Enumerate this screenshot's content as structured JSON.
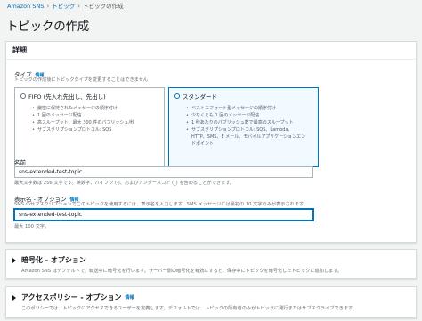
{
  "breadcrumb": {
    "items": [
      "Amazon SNS",
      "トピック",
      "トピックの作成"
    ]
  },
  "page": {
    "title": "トピックの作成"
  },
  "details": {
    "heading": "詳細",
    "type": {
      "label": "タイプ",
      "info": "情報",
      "description": "トピックの作成後にトピックタイプを変更することはできません",
      "options": [
        {
          "label": "FIFO (先入れ先出し、先出し)",
          "selected": false,
          "bullets": [
            "厳密に保持されたメッセージの順序付け",
            "1 回のメッセージ配信",
            "高スループット、最大 300 件のパブリッシュ/秒",
            "サブスクリプションプロトコル: SQS"
          ]
        },
        {
          "label": "スタンダード",
          "selected": true,
          "bullets": [
            "ベストエフォート型メッセージの順序付け",
            "少なくとも 1 回のメッセージ配信",
            "1 秒あたりのパブリッシュ数で最高のスループット",
            "サブスクリプションプロトコル: SQS、Lambda、",
            "HTTP、SMS、E メール、モバイルアプリケーションエン",
            "ドポイント"
          ]
        }
      ]
    },
    "name": {
      "label": "名前",
      "value": "sns-extended-test-topic",
      "hint": "最大文字数は 256 文字です。英数字、ハイフン (-)、およびアンダースコア (_) を含めることができます。"
    },
    "display_name": {
      "label": "表示名 - オプション",
      "info": "情報",
      "description": "SMS のサブスクリプションでこのトピックを使用するには、表示名を入力します。SMS メッセージには最初の 10 文字のみが表示されます。",
      "value": "sns-extended-test-topic",
      "hint": "最大 100 文字。"
    }
  },
  "encryption": {
    "title": "暗号化 - オプション",
    "description": "Amazon SNS はデフォルトで、転送中に暗号化を行います。サーバー側の暗号化を有効にすると、保存中にトピックを暗号化したトピックに追加します。"
  },
  "access_policy": {
    "title": "アクセスポリシー - オプション",
    "info": "情報",
    "description": "このポリシーでは、トピックにアクセスできるユーザーを定義します。デフォルトでは、トピックの所有者のみがトピックに発行またはサブスクライブできます。"
  },
  "colors": {
    "accent": "#0073bb",
    "background": "#f2f3f3",
    "panel": "#ffffff"
  }
}
